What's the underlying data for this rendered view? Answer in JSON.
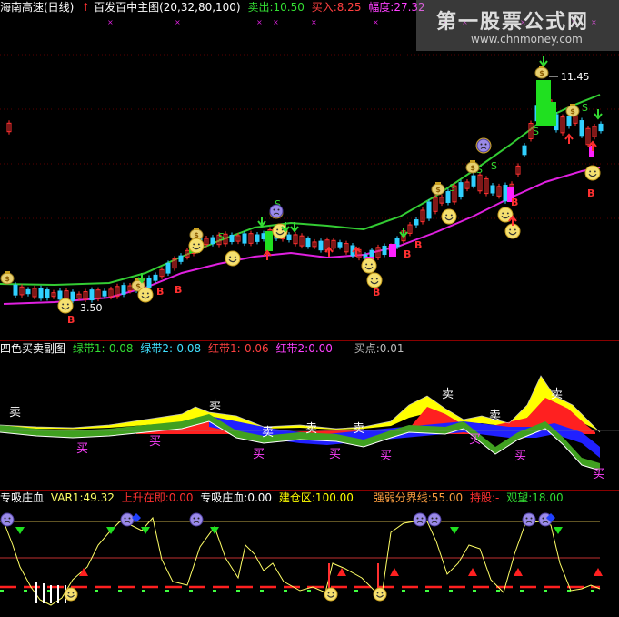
{
  "main": {
    "stock_name": "海南高速(日线)",
    "arrow_glyph": "↑",
    "indicator_name": "百发百中主图(20,32,80,100)",
    "sell_label": "卖出:10.50",
    "buy_label": "买入:8.25",
    "range_label": "幅度:27.32",
    "high_label": "11.45",
    "low_label": "3.50",
    "sell_marker": "S",
    "buy_marker": "B"
  },
  "mid": {
    "title": "四色买卖副图",
    "green1": "绿带1:-0.08",
    "green2": "绿带2:-0.08",
    "red1": "红带1:-0.06",
    "red2": "红带2:0.00",
    "buy_point": "买点:0.01",
    "sell_word": "卖",
    "buy_word": "买"
  },
  "bottom": {
    "title": "专吸庄血",
    "var1": "VAR1:49.32",
    "rise": "上升在即:0.00",
    "title2": "专吸庄血:0.00",
    "build": "建仓区:100.00",
    "divide": "强弱分界线:55.00",
    "hold": "持股:-",
    "watch": "观望:18.00"
  },
  "watermark": {
    "title": "第一股票公式网",
    "url": "www.chnmoney.com"
  },
  "colors": {
    "green_line": "#33cc33",
    "magenta_line": "#e020e0",
    "up_red": "#ff3030",
    "down_cyan": "#30d0ff",
    "yellow": "#ffff00"
  }
}
